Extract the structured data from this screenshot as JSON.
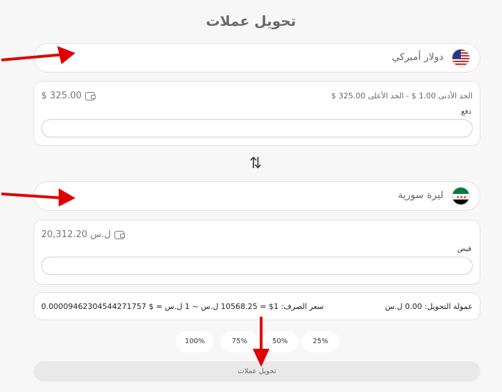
{
  "page": {
    "title": "تحويل عملات"
  },
  "from": {
    "currency": "دولار أميركي",
    "balance": "$ 325.00",
    "limits": "الحد الأدنى 1.00 $   -   الحد الأعلى 325.00 $",
    "field_label": "دفع",
    "value": ""
  },
  "to": {
    "currency": "ليرة سورية",
    "balance": "ل.س 20,312.20",
    "field_label": "قبض",
    "value": ""
  },
  "info": {
    "fee": "عمولة التحويل: 0.00 ل.س",
    "rate": "سعر الصرف: 1$ = 10568.25 ل.س ~ 1 ل.س = $ 0.00009462304544271757"
  },
  "percent_buttons": [
    "25%",
    "50%",
    "75%",
    "100%"
  ],
  "submit_label": "تحويل عملات",
  "annotations": {
    "arrow_color": "#e00000"
  }
}
